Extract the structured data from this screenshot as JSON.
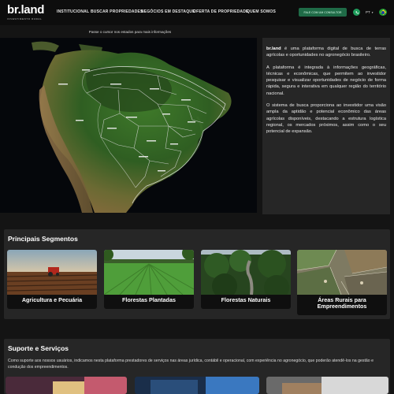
{
  "header": {
    "logo_text": "br.land",
    "logo_tagline": "INVESTIMENTO RURAL",
    "nav": [
      "INSTITUCIONAL",
      "BUSCAR PROPRIEDADES",
      "NEGÓCIOS EM DESTAQUE",
      "OFERTA DE PROPRIEDADE",
      "QUEM SOMOS"
    ],
    "cta_label": "FALE COM UM CONSULTOR",
    "language": "PT",
    "colors": {
      "cta": "#1f6b47",
      "phone": "#1f9d5c"
    }
  },
  "map": {
    "hint": "Passe o cursor nos estados para mais informações"
  },
  "info": {
    "brand": "br.land",
    "p1_rest": " é uma plataforma digital de busca de terras agrícolas e oportunidades no agronegócio brasileiro.",
    "p2": "A plataforma é integrada à informações geográficas, técnicas e econômicas, que permitem ao investidor pesquisar e visualizar oportunidades de negócio de forma rápida, segura e interativa em qualquer região do território nacional.",
    "p3": "O sistema de busca proporciona ao investidor uma visão ampla da aptidão e potencial econômico das áreas agrícolas disponíveis, destacando a estrutura logística regional, os mercados próximos, assim como o seu potencial de expansão."
  },
  "segments": {
    "title": "Principais Segmentos",
    "items": [
      {
        "label": "Agricultura e Pecuária"
      },
      {
        "label": "Florestas Plantadas"
      },
      {
        "label": "Florestas Naturais"
      },
      {
        "label": "Áreas Rurais para Empreendimentos"
      }
    ]
  },
  "support": {
    "title": "Suporte e Serviços",
    "text": "Como suporte aos nossos usuários, indicamos nesta plataforma prestadores de serviços nas áreas jurídica, contábil e operacional, com experiência no agronegócio, que poderão atendê-los na gestão e condução dos empreendimentos."
  }
}
